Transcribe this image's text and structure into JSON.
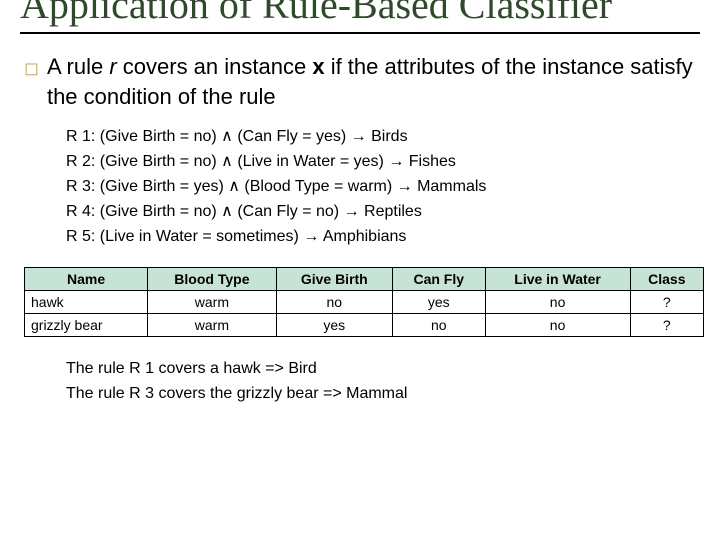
{
  "title": "Application of Rule-Based Classifier",
  "lead": {
    "pre": "A rule ",
    "r": "r",
    "mid": " covers an instance ",
    "x": "x",
    "post": " if the attributes of the instance satisfy the condition of the rule"
  },
  "rules": [
    "R 1: (Give Birth = no) ∧ (Can Fly = yes) → Birds",
    "R 2: (Give Birth = no) ∧ (Live in Water = yes) → Fishes",
    "R 3: (Give Birth = yes) ∧ (Blood Type = warm) → Mammals",
    "R 4: (Give Birth = no) ∧ (Can Fly = no) → Reptiles",
    "R 5: (Live in Water = sometimes) → Amphibians"
  ],
  "table": {
    "headers": [
      "Name",
      "Blood Type",
      "Give Birth",
      "Can Fly",
      "Live in Water",
      "Class"
    ],
    "rows": [
      [
        "hawk",
        "warm",
        "no",
        "yes",
        "no",
        "?"
      ],
      [
        "grizzly bear",
        "warm",
        "yes",
        "no",
        "no",
        "?"
      ]
    ]
  },
  "conclusions": [
    "The rule R 1 covers a hawk => Bird",
    "The rule R 3 covers the grizzly bear => Mammal"
  ]
}
